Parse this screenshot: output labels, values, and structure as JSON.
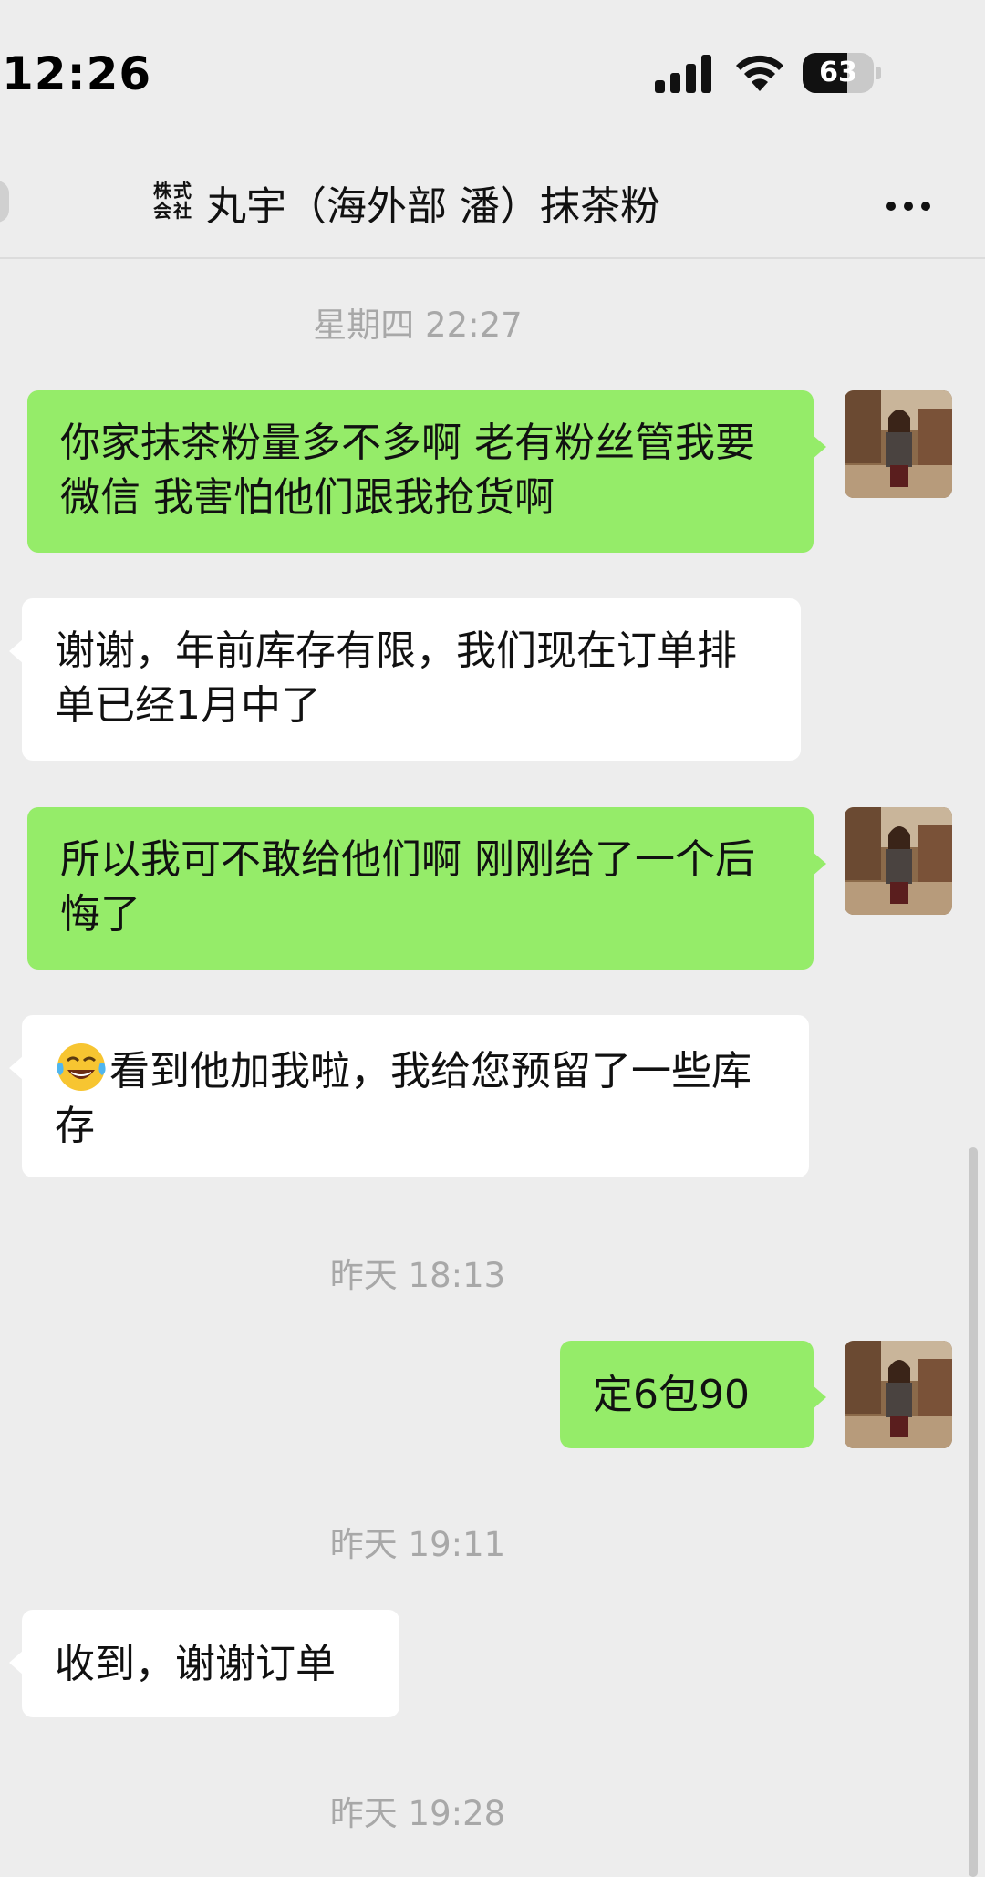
{
  "status_bar": {
    "time": "12:26",
    "battery": "63",
    "battery_level": 0.63
  },
  "header": {
    "badge_line1": "株式",
    "badge_line2": "会社",
    "title": "丸宇（海外部 潘）抹茶粉",
    "more_icon": "more-horizontal-icon"
  },
  "messages": [
    {
      "kind": "timestamp",
      "text": "星期四 22:27"
    },
    {
      "kind": "sent",
      "text": "你家抹茶粉量多不多啊 老有粉丝管我要微信 我害怕他们跟我抢货啊"
    },
    {
      "kind": "received",
      "text": "谢谢，年前库存有限，我们现在订单排单已经1月中了"
    },
    {
      "kind": "sent",
      "text": "所以我可不敢给他们啊 刚刚给了一个后悔了"
    },
    {
      "kind": "received",
      "emoji": "face-with-tears-of-joy",
      "text": "看到他加我啦，我给您预留了一些库存"
    },
    {
      "kind": "timestamp",
      "text": "昨天 18:13"
    },
    {
      "kind": "sent",
      "text": "定6包90"
    },
    {
      "kind": "timestamp",
      "text": "昨天 19:11"
    },
    {
      "kind": "received",
      "text": "收到，谢谢订单"
    },
    {
      "kind": "timestamp",
      "text": "昨天 19:28"
    }
  ],
  "colors": {
    "background": "#ededed",
    "sent_bubble": "#95ec69",
    "received_bubble": "#ffffff",
    "timestamp": "#a8a8a8"
  }
}
